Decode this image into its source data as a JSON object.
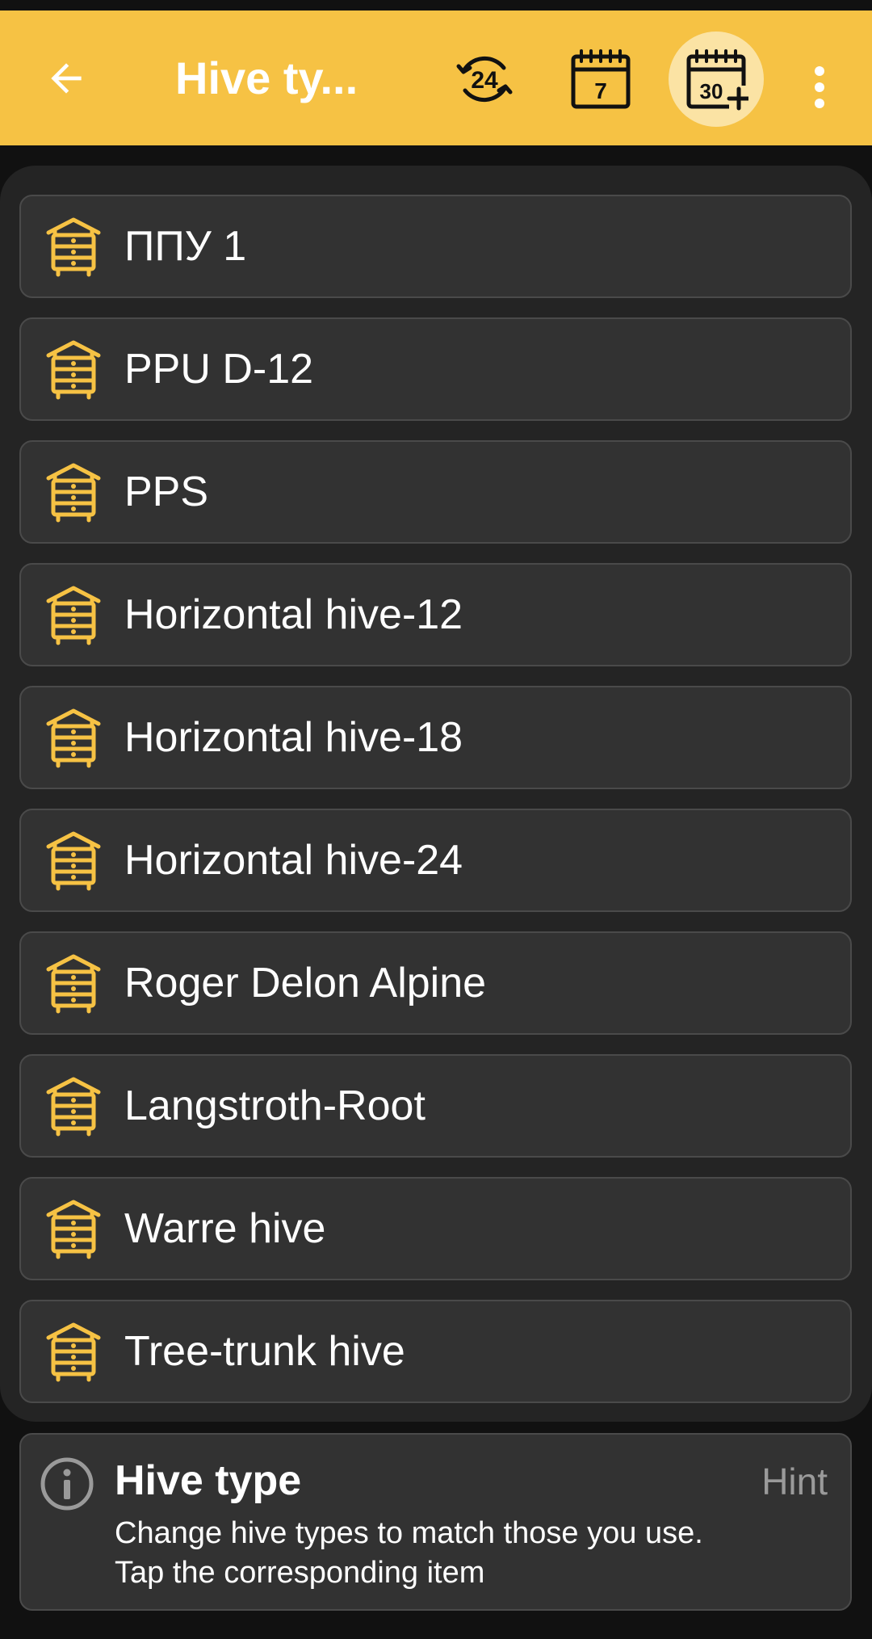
{
  "app_bar": {
    "title": "Hive ty...",
    "back_icon": "arrow-left-icon",
    "actions": [
      {
        "icon": "period-24h-icon",
        "label": "24",
        "active": false
      },
      {
        "icon": "calendar-7-days-icon",
        "label": "7",
        "active": false
      },
      {
        "icon": "calendar-30-plus-icon",
        "label": "30",
        "active": true
      }
    ],
    "more_icon": "more-vertical-icon",
    "accent_color": "#f6c244"
  },
  "hive_types": [
    {
      "label": "ППУ 1",
      "icon": "hive-icon"
    },
    {
      "label": "PPU D-12",
      "icon": "hive-icon"
    },
    {
      "label": "PPS",
      "icon": "hive-icon"
    },
    {
      "label": "Horizontal hive-12",
      "icon": "hive-icon"
    },
    {
      "label": "Horizontal hive-18",
      "icon": "hive-icon"
    },
    {
      "label": "Horizontal hive-24",
      "icon": "hive-icon"
    },
    {
      "label": "Roger Delon Alpine",
      "icon": "hive-icon"
    },
    {
      "label": "Langstroth-Root",
      "icon": "hive-icon"
    },
    {
      "label": "Warre hive",
      "icon": "hive-icon"
    },
    {
      "label": "Tree-trunk hive",
      "icon": "hive-icon"
    }
  ],
  "hint": {
    "icon": "info-icon",
    "title": "Hive type",
    "tag": "Hint",
    "line1": "Change hive types to match those you use.",
    "line2": "Tap the corresponding item"
  },
  "colors": {
    "icon_yellow": "#f6c244",
    "background": "#111111",
    "panel": "#242424",
    "card": "#323232"
  }
}
